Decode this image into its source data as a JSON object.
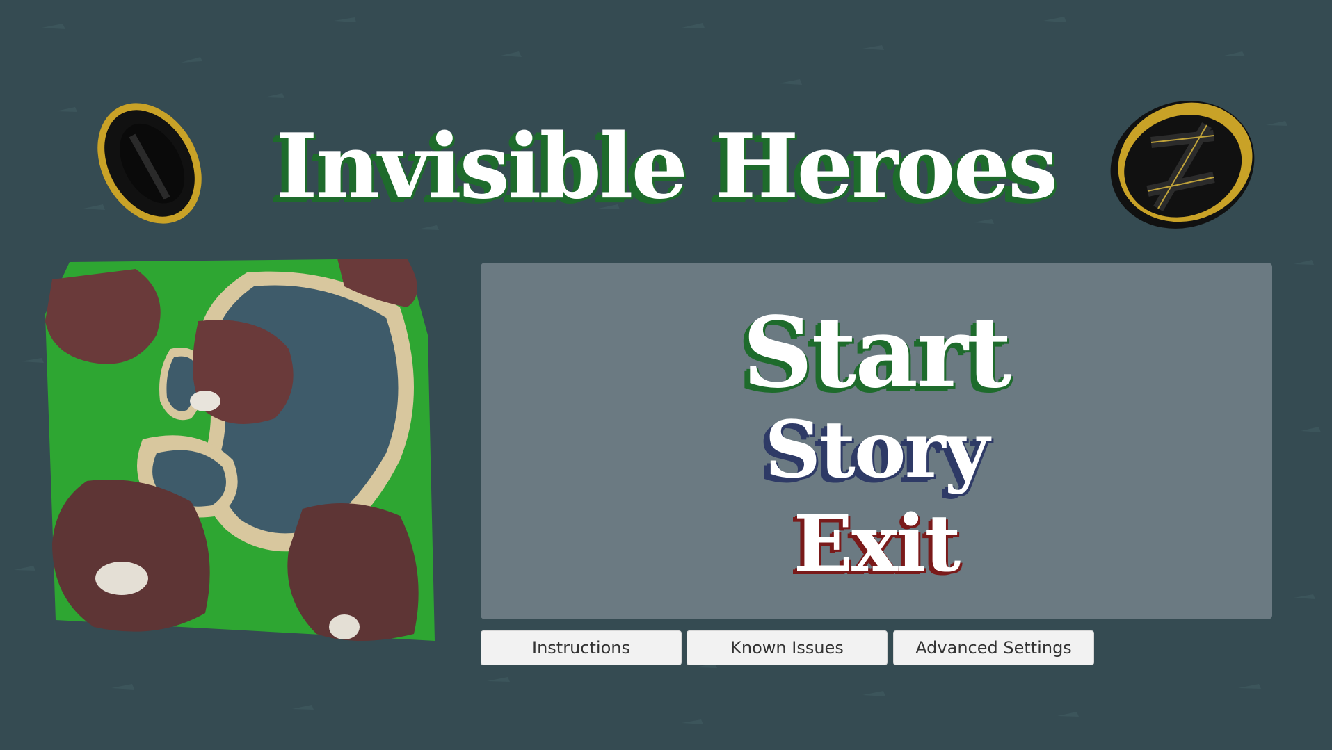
{
  "game_title": "Invisible Heroes",
  "menu": {
    "start_label": "Start",
    "story_label": "Story",
    "exit_label": "Exit"
  },
  "buttons": {
    "instructions_label": "Instructions",
    "known_issues_label": "Known Issues",
    "advanced_settings_label": "Advanced Settings"
  },
  "colors": {
    "background": "#354b52",
    "panel": "#6b7a82",
    "start_shadow": "#1e6b2c",
    "story_shadow": "#2e3a66",
    "exit_shadow": "#7a1a1a",
    "ring_gold": "#c9a227"
  },
  "icons": [
    "gold-ring-icon",
    "gold-ring-emblem-icon"
  ]
}
